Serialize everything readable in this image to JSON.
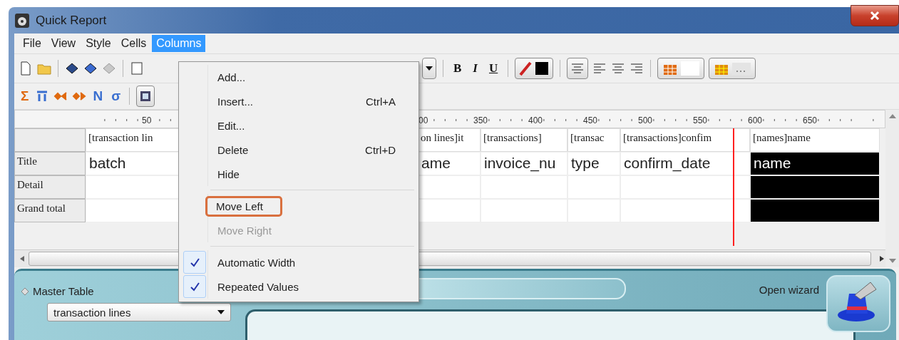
{
  "window": {
    "title": "Quick Report"
  },
  "menu_bar": [
    {
      "label": "File",
      "selected": false
    },
    {
      "label": "View",
      "selected": false
    },
    {
      "label": "Style",
      "selected": false
    },
    {
      "label": "Cells",
      "selected": false
    },
    {
      "label": "Columns",
      "selected": true
    }
  ],
  "toolbar_format": [
    {
      "kind": "text",
      "label": "B"
    },
    {
      "kind": "text",
      "label": "I"
    },
    {
      "kind": "text",
      "label": "U"
    }
  ],
  "toolbar_functions": [
    {
      "label": "Σ",
      "color": "#e06a10"
    },
    {
      "label": "N",
      "color": "#3a6fd0"
    },
    {
      "label": "σ",
      "color": "#3a6fd0"
    }
  ],
  "ruler": [
    "50",
    "00",
    "350",
    "400",
    "450",
    "500",
    "550",
    "600",
    "650"
  ],
  "grid": {
    "columns": [
      {
        "header": "[transaction lin",
        "selected": false
      },
      {
        "header": "on lines]it",
        "selected": false
      },
      {
        "header": "[transactions]",
        "selected": false
      },
      {
        "header": "[transac",
        "selected": false
      },
      {
        "header": "[transactions]confim",
        "selected": false
      },
      {
        "header": "[names]name",
        "selected": true
      }
    ],
    "rows": [
      {
        "label": "Title",
        "cells": [
          "batch",
          "ame",
          "invoice_nu",
          "type",
          "confirm_date",
          "name"
        ]
      },
      {
        "label": "Detail"
      },
      {
        "label": "Grand total"
      }
    ]
  },
  "columns_menu": [
    {
      "kind": "item",
      "label": "Add...",
      "disabled": false,
      "highlighted": false
    },
    {
      "kind": "item",
      "label": "Insert...",
      "shortcut": "Ctrl+A",
      "disabled": false,
      "highlighted": false
    },
    {
      "kind": "item",
      "label": "Edit...",
      "disabled": false,
      "highlighted": false
    },
    {
      "kind": "item",
      "label": "Delete",
      "shortcut": "Ctrl+D",
      "disabled": false,
      "highlighted": false
    },
    {
      "kind": "item",
      "label": "Hide",
      "disabled": false,
      "highlighted": false
    },
    {
      "kind": "separator"
    },
    {
      "kind": "item",
      "label": "Move Left",
      "disabled": false,
      "highlighted": true
    },
    {
      "kind": "item",
      "label": "Move Right",
      "disabled": true,
      "highlighted": false
    },
    {
      "kind": "separator"
    },
    {
      "kind": "check",
      "label": "Automatic Width",
      "checked": true
    },
    {
      "kind": "check",
      "label": "Repeated Values",
      "checked": true
    }
  ],
  "bottom_panel": {
    "master_table_label": "Master Table",
    "master_table_value": "transaction lines",
    "wizard_label": "Open wizard"
  }
}
